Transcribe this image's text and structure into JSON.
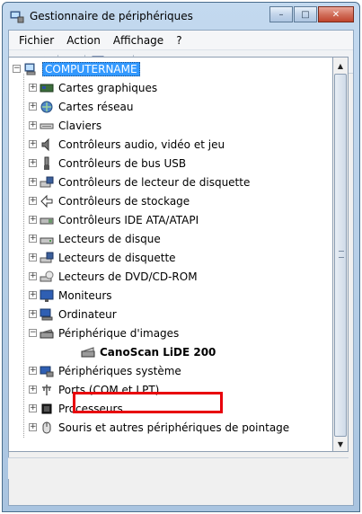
{
  "window": {
    "title": "Gestionnaire de périphériques",
    "buttons": {
      "minimize": "–",
      "maximize": "□",
      "close": "✕"
    }
  },
  "menu": [
    "Fichier",
    "Action",
    "Affichage",
    "?"
  ],
  "toolbar": [
    "back-arrow-icon",
    "forward-arrow-icon",
    "properties-icon",
    "help-icon",
    "view-icon",
    "scan-hardware-icon"
  ],
  "tree": {
    "root": "COMPUTERNAME",
    "categories": [
      {
        "label": "Cartes graphiques",
        "icon": "display-adapter-icon"
      },
      {
        "label": "Cartes réseau",
        "icon": "network-adapter-icon"
      },
      {
        "label": "Claviers",
        "icon": "keyboard-icon"
      },
      {
        "label": "Contrôleurs audio, vidéo et jeu",
        "icon": "speaker-icon"
      },
      {
        "label": "Contrôleurs de bus USB",
        "icon": "usb-icon"
      },
      {
        "label": "Contrôleurs de lecteur de disquette",
        "icon": "floppy-controller-icon"
      },
      {
        "label": "Contrôleurs de stockage",
        "icon": "storage-controller-icon"
      },
      {
        "label": "Contrôleurs IDE ATA/ATAPI",
        "icon": "ide-controller-icon"
      },
      {
        "label": "Lecteurs de disque",
        "icon": "disk-drive-icon"
      },
      {
        "label": "Lecteurs de disquette",
        "icon": "floppy-drive-icon"
      },
      {
        "label": "Lecteurs de DVD/CD-ROM",
        "icon": "dvd-drive-icon"
      },
      {
        "label": "Moniteurs",
        "icon": "monitor-icon"
      },
      {
        "label": "Ordinateur",
        "icon": "computer-icon"
      },
      {
        "label": "Périphérique d'images",
        "icon": "imaging-device-icon"
      },
      {
        "label": "Périphériques système",
        "icon": "system-device-icon"
      },
      {
        "label": "Ports (COM et LPT)",
        "icon": "port-icon"
      },
      {
        "label": "Processeurs",
        "icon": "processor-icon"
      },
      {
        "label": "Souris et autres périphériques de pointage",
        "icon": "mouse-icon"
      }
    ],
    "child_device": "CanoScan LiDE 200"
  }
}
